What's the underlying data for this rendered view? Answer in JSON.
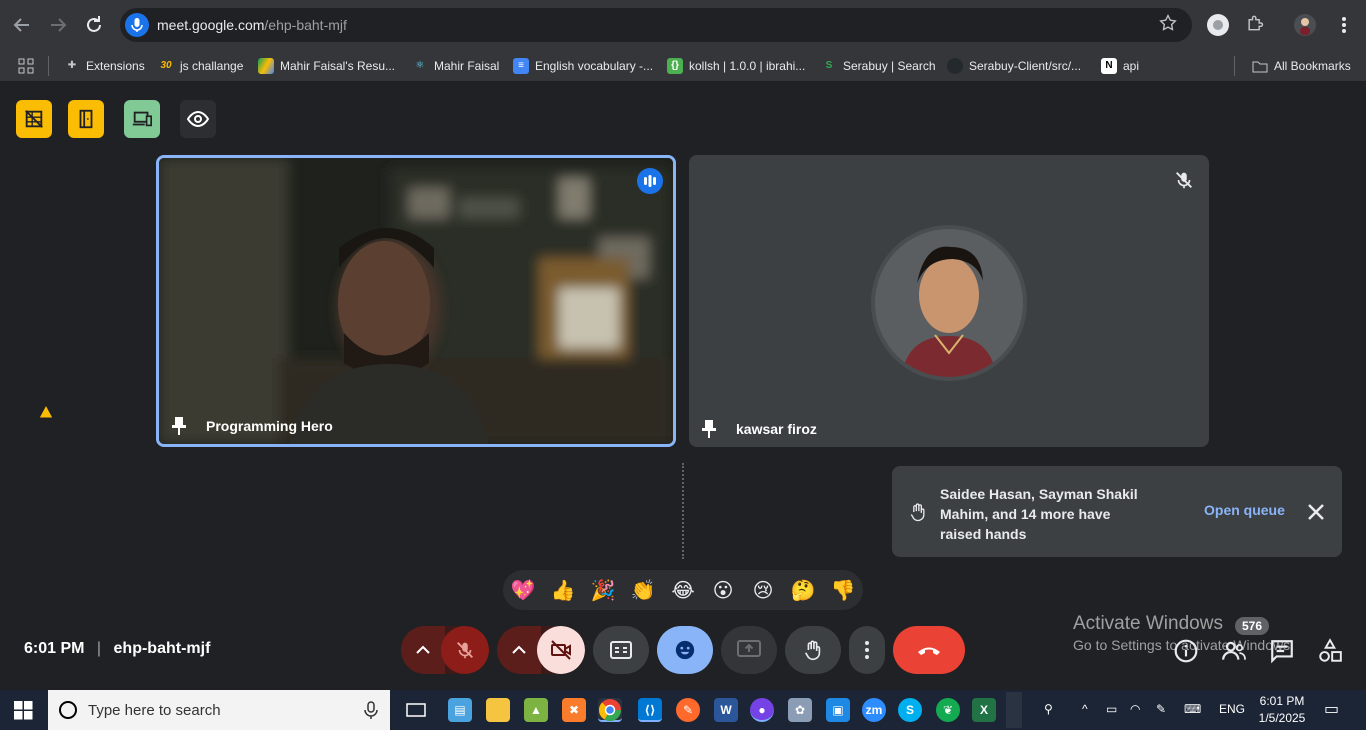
{
  "browser": {
    "url_host": "meet.google.com",
    "url_path": "/ehp-baht-mjf",
    "bookmarks": [
      {
        "label": "Extensions",
        "icon": "puzzle-icon"
      },
      {
        "label": "js challange",
        "icon": "30-icon"
      },
      {
        "label": "Mahir Faisal's Resu...",
        "icon": "drive-icon"
      },
      {
        "label": "Mahir Faisal",
        "icon": "react-icon"
      },
      {
        "label": "English vocabulary -...",
        "icon": "docs-icon"
      },
      {
        "label": "kollsh | 1.0.0 | ibrahi...",
        "icon": "bracket-icon"
      },
      {
        "label": "Serabuy | Search",
        "icon": "serabuy-icon"
      },
      {
        "label": "Serabuy-Client/src/...",
        "icon": "github-icon"
      },
      {
        "label": "api",
        "icon": "notion-icon"
      }
    ],
    "all_bookmarks": "All Bookmarks"
  },
  "meet": {
    "tiles": [
      {
        "name": "Programming Hero",
        "speaking": true
      },
      {
        "name": "kawsar firoz",
        "muted": true
      }
    ],
    "notice": {
      "text": "Saidee Hasan, Sayman Shakil Mahim, and 14 more have raised hands",
      "action": "Open queue"
    },
    "reactions": [
      "💖",
      "👍",
      "🎉",
      "👏",
      "😂",
      "😮",
      "😢",
      "🤔",
      "👎"
    ],
    "time": "6:01 PM",
    "separator": "|",
    "meeting_code": "ehp-baht-mjf",
    "badge_count": "576"
  },
  "watermark": {
    "line1": "Activate Windows",
    "line2": "Go to Settings to activate Windows."
  },
  "taskbar": {
    "search_placeholder": "Type here to search",
    "lang": "ENG",
    "clock_time": "6:01 PM",
    "clock_date": "1/5/2025"
  },
  "colors": {
    "accent_blue": "#8ab4f8",
    "end_call_red": "#ea4335",
    "muted_red": "#8c1d18",
    "top_yellow": "#fbbc04",
    "top_green": "#81c995"
  }
}
